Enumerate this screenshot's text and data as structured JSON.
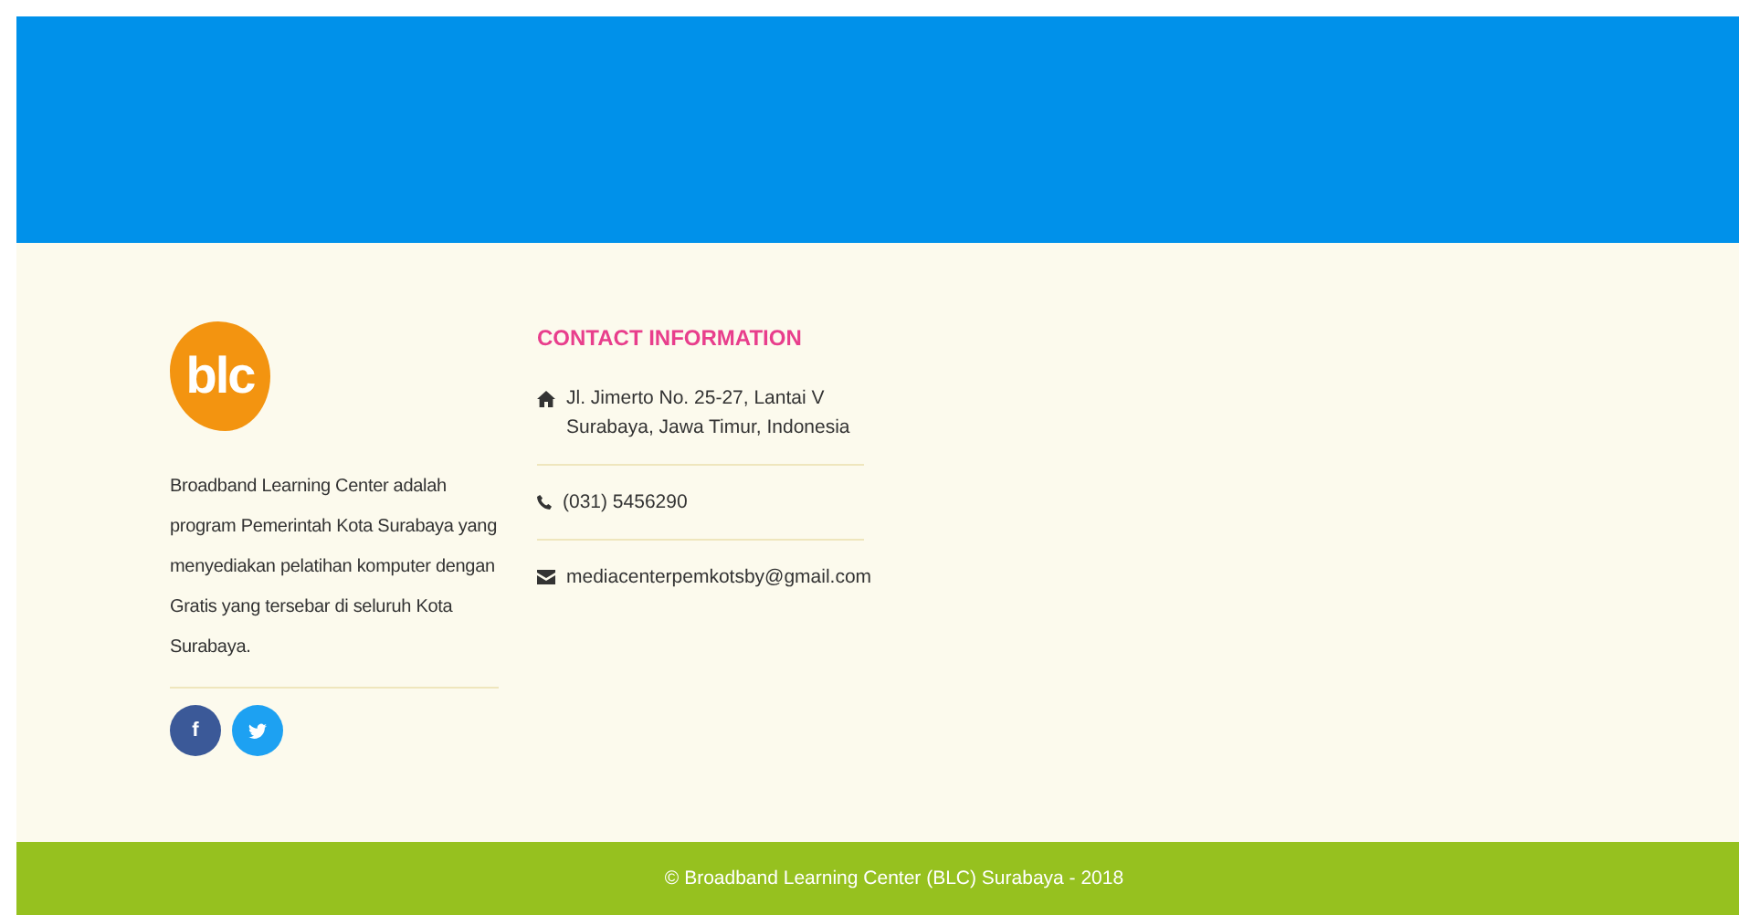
{
  "logo": {
    "text": "blc"
  },
  "about": {
    "text": "Broadband Learning Center adalah program Pemerintah Kota Surabaya yang menyediakan pelatihan komputer dengan Gratis yang tersebar di seluruh Kota Surabaya."
  },
  "social": [
    {
      "kind": "facebook",
      "glyph": "f"
    },
    {
      "kind": "twitter"
    }
  ],
  "contact": {
    "title": "CONTACT INFORMATION",
    "items": [
      {
        "kind": "address",
        "lines": [
          "Jl. Jimerto No. 25-27, Lantai V",
          "Surabaya, Jawa Timur, Indonesia"
        ]
      },
      {
        "kind": "phone",
        "lines": [
          "(031) 5456290"
        ]
      },
      {
        "kind": "email",
        "lines": [
          "mediacenterpemkotsby@gmail.com"
        ]
      }
    ]
  },
  "footer": {
    "text": "© Broadband Learning Center (BLC) Surabaya - 2018"
  }
}
